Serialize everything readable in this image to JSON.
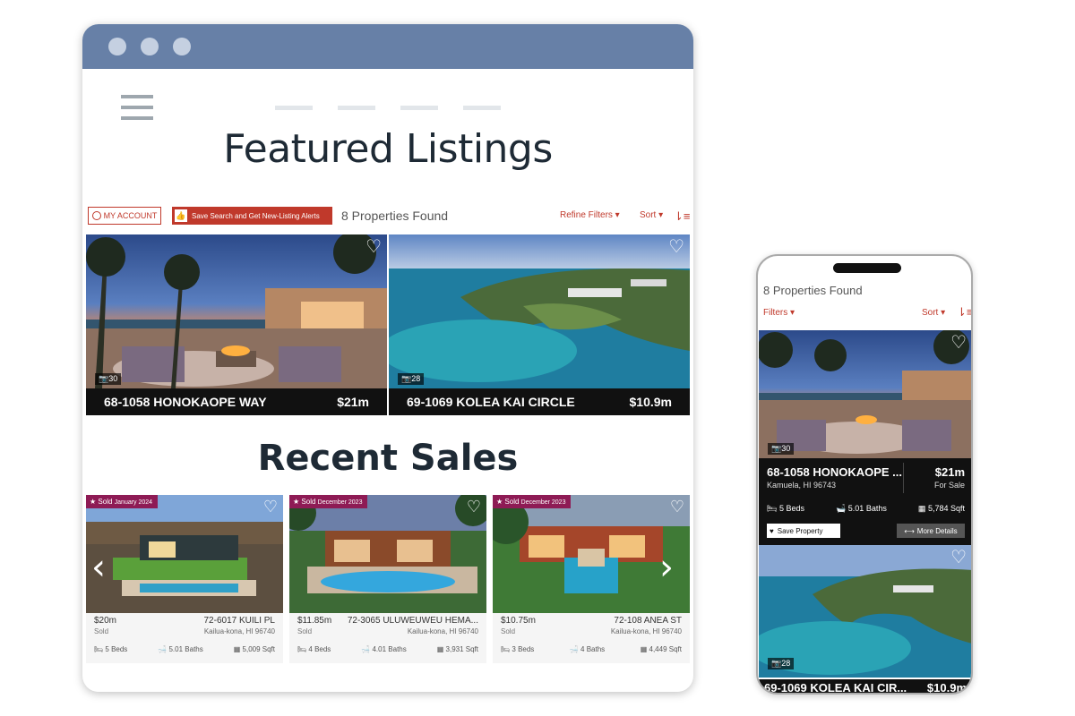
{
  "desktop": {
    "page_title": "Featured Listings",
    "my_account_label": "MY ACCOUNT",
    "save_search_label": "Save Search and Get New-Listing Alerts",
    "properties_found": "8 Properties Found",
    "refine_filters_label": "Refine Filters",
    "sort_label": "Sort",
    "featured": [
      {
        "address": "68-1058 HONOKAOPE WAY",
        "price": "$21m",
        "photo_count": "30"
      },
      {
        "address": "69-1069 KOLEA KAI CIRCLE",
        "price": "$10.9m",
        "photo_count": "28"
      }
    ],
    "sales_title": "Recent Sales",
    "sales": [
      {
        "badge_prefix": "Sold",
        "badge_date": "January 2024",
        "price": "$20m",
        "status": "Sold",
        "address": "72-6017 KUILI PL",
        "city": "Kailua-kona, HI 96740",
        "beds": "5 Beds",
        "baths": "5.01 Baths",
        "sqft": "5,009 Sqft"
      },
      {
        "badge_prefix": "Sold",
        "badge_date": "December 2023",
        "price": "$11.85m",
        "status": "Sold",
        "address": "72-3065 ULUWEUWEU HEMA...",
        "city": "Kailua-kona, HI 96740",
        "beds": "4 Beds",
        "baths": "4.01 Baths",
        "sqft": "3,931 Sqft"
      },
      {
        "badge_prefix": "Sold",
        "badge_date": "December 2023",
        "price": "$10.75m",
        "status": "Sold",
        "address": "72-108 ANEA ST",
        "city": "Kailua-kona, HI 96740",
        "beds": "3 Beds",
        "baths": "4 Baths",
        "sqft": "4,449 Sqft"
      }
    ]
  },
  "mobile": {
    "properties_found": "8 Properties Found",
    "filters_label": "Filters",
    "sort_label": "Sort",
    "card1": {
      "address": "68-1058 HONOKAOPE ...",
      "city": "Kamuela, HI 96743",
      "price": "$21m",
      "status": "For Sale",
      "photo_count": "30",
      "beds": "5 Beds",
      "baths": "5.01 Baths",
      "sqft": "5,784 Sqft",
      "save_label": "Save Property",
      "more_label": "More Details"
    },
    "card2": {
      "address": "69-1069 KOLEA KAI CIR...",
      "price": "$10.9m",
      "photo_count": "28"
    }
  },
  "colors": {
    "accent": "#c0392b",
    "browser_bar": "#6780a7",
    "sold_badge": "#8e1b55"
  },
  "icons": [
    "hamburger-icon",
    "user-icon",
    "thumbs-up-icon",
    "sort-icon",
    "heart-icon",
    "camera-icon",
    "star-icon",
    "bed-icon",
    "bath-icon",
    "sqft-icon",
    "chevron-left-icon",
    "chevron-right-icon",
    "expand-icon"
  ]
}
